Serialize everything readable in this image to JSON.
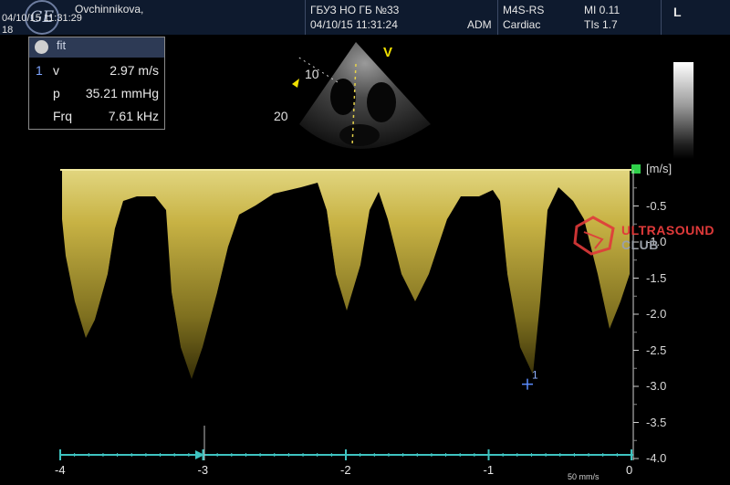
{
  "header": {
    "patient_name": "Ovchinnikova,",
    "date_top": "04/10/15 11:31:29",
    "date_cont": "18",
    "institution": "ГБУЗ НО ГБ №33",
    "date_time": "04/10/15 11:31:24",
    "operator": "ADM",
    "probe": "M4S-RS",
    "preset": "Cardiac",
    "mi": "MI 0.11",
    "tis": "TIs 1.7",
    "orientation": "L",
    "logo_text": "GE"
  },
  "measurement": {
    "header_control": "fit",
    "index": "1",
    "rows": [
      {
        "label": "v",
        "value": "2.97 m/s"
      },
      {
        "label": "p",
        "value": "35.21 mmHg"
      },
      {
        "label": "Frq",
        "value": "7.61 kHz"
      }
    ]
  },
  "sector": {
    "marker": "V",
    "depth_labels": [
      "10",
      "20"
    ]
  },
  "velocity_scale": {
    "unit": "[m/s]",
    "ticks": [
      "-0.5",
      "-1.0",
      "-1.5",
      "-2.0",
      "-2.5",
      "-3.0",
      "-3.5",
      "-4.0"
    ],
    "tick_values": [
      -0.5,
      -1.0,
      -1.5,
      -2.0,
      -2.5,
      -3.0,
      -3.5,
      -4.0
    ],
    "range": [
      0,
      -4.0
    ]
  },
  "time_axis": {
    "ticks": [
      "-4",
      "-3",
      "-2",
      "-1",
      "0"
    ],
    "sweep_speed": "50 mm/s"
  },
  "caliper": {
    "label": "1",
    "value_ms": -2.97
  },
  "watermark": {
    "line1": "ULTRASOUND",
    "line2": "CLUB"
  },
  "colors": {
    "header_bg": "#0e1a2e",
    "doppler": "#e8d96a",
    "baseline": "#f2e9a0",
    "timeline": "#3ec3c0",
    "caliper": "#5a8cff",
    "watermark_red": "#e03a3a",
    "watermark_gray": "#9aa0a8",
    "marker_yellow": "#f0e000"
  }
}
